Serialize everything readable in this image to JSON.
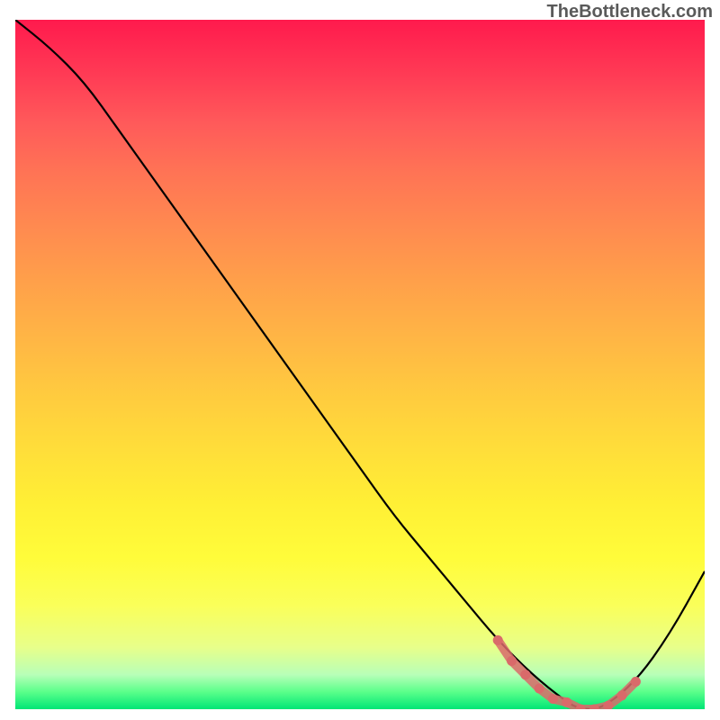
{
  "watermark": "TheBottleneck.com",
  "chart_data": {
    "type": "line",
    "title": "",
    "xlabel": "",
    "ylabel": "",
    "xlim": [
      0,
      100
    ],
    "ylim": [
      0,
      100
    ],
    "series": [
      {
        "name": "curve",
        "color": "#000000",
        "x": [
          0,
          5,
          10,
          15,
          20,
          25,
          30,
          35,
          40,
          45,
          50,
          55,
          60,
          65,
          70,
          75,
          80,
          82,
          85,
          90,
          95,
          100
        ],
        "y": [
          100,
          96,
          91,
          84,
          77,
          70,
          63,
          56,
          49,
          42,
          35,
          28,
          22,
          16,
          10,
          5,
          1,
          0,
          0,
          4,
          11,
          20
        ]
      },
      {
        "name": "highlight",
        "color": "#d96a6a",
        "style": "thick-dotted",
        "x": [
          70,
          72,
          74,
          76,
          78,
          80,
          82,
          84,
          86,
          88,
          90
        ],
        "y": [
          10,
          7,
          5,
          3,
          1.5,
          1,
          0,
          0,
          0.5,
          2,
          4
        ]
      }
    ]
  }
}
